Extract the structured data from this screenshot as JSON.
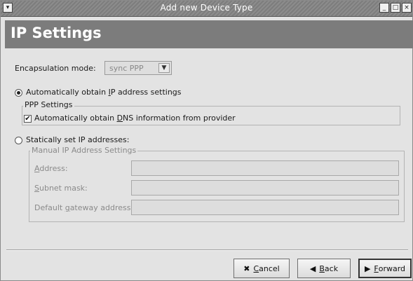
{
  "window": {
    "title": "Add new Device Type",
    "menu_icon": "window-menu-icon",
    "controls": {
      "minimize": "_",
      "maximize": "□",
      "close": "×"
    }
  },
  "header": {
    "title": "IP Settings"
  },
  "encapsulation": {
    "label_pre": "Encapsulation mode:",
    "value": "sync PPP",
    "arrow": "▼"
  },
  "auto_ip": {
    "label_pre": "Automatically obtain ",
    "label_ul": "I",
    "label_post": "P address settings",
    "selected": true
  },
  "ppp_settings": {
    "legend": "PPP Settings",
    "dns_pre": "Automatically obtain ",
    "dns_ul": "D",
    "dns_post": "NS information from provider",
    "dns_checked": true
  },
  "static_ip": {
    "label": "Statically set IP addresses:",
    "selected": false
  },
  "manual": {
    "legend": "Manual IP Address Settings",
    "address_ul": "A",
    "address_post": "ddress:",
    "subnet_ul": "S",
    "subnet_post": "ubnet mask:",
    "gateway_pre": "Default ",
    "gateway_ul": "g",
    "gateway_post": "ateway address:",
    "address_value": "",
    "subnet_value": "",
    "gateway_value": ""
  },
  "buttons": {
    "cancel_icon": "✖",
    "cancel_ul": "C",
    "cancel_post": "ancel",
    "back_icon": "◀",
    "back_ul": "B",
    "back_post": "ack",
    "forward_icon": "▶",
    "forward_ul": "F",
    "forward_post": "orward"
  }
}
